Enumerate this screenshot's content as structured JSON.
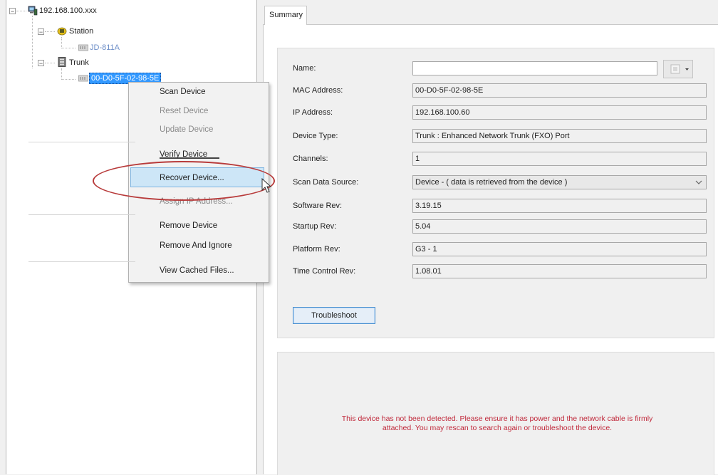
{
  "tree": {
    "root_label": "192.168.100.xxx",
    "station_label": "Station",
    "station_device_label": "JD-811A",
    "trunk_label": "Trunk",
    "trunk_device_label": "00-D0-5F-02-98-5E",
    "expand_symbol": "−"
  },
  "tabs": {
    "summary": "Summary"
  },
  "context_menu": {
    "items": [
      {
        "label": "Scan Device",
        "enabled": true
      },
      {
        "label": "Reset Device",
        "enabled": false
      },
      {
        "label": "Update Device",
        "enabled": false
      },
      {
        "label": "Verify Device",
        "enabled": true
      },
      {
        "label": "Recover Device...",
        "enabled": true
      },
      {
        "label": "Assign IP Address...",
        "enabled": false
      },
      {
        "label": "Remove Device",
        "enabled": true
      },
      {
        "label": "Remove And Ignore",
        "enabled": true
      },
      {
        "label": "View Cached Files...",
        "enabled": true
      }
    ]
  },
  "form": {
    "name_label": "Name:",
    "name_value": "",
    "mac_label": "MAC Address:",
    "mac_value": "00-D0-5F-02-98-5E",
    "ip_label": "IP Address:",
    "ip_value": "192.168.100.60",
    "device_type_label": "Device Type:",
    "device_type_value": "Trunk : Enhanced Network Trunk (FXO) Port",
    "channels_label": "Channels:",
    "channels_value": "1",
    "scan_source_label": "Scan Data Source:",
    "scan_source_value": "Device - ( data is retrieved from the device )",
    "software_rev_label": "Software Rev:",
    "software_rev_value": "3.19.15",
    "startup_rev_label": "Startup Rev:",
    "startup_rev_value": "5.04",
    "platform_rev_label": "Platform Rev:",
    "platform_rev_value": "G3 - 1",
    "time_control_rev_label": "Time Control Rev:",
    "time_control_rev_value": "1.08.01",
    "troubleshoot_label": "Troubleshoot"
  },
  "message": {
    "line1": "This device has not been detected.  Please ensure it has power and the network cable is firmly",
    "line2": "attached.  You may rescan to search again or troubleshoot the device."
  },
  "colors": {
    "selection": "#3399ff",
    "message_red": "#c0283a",
    "highlight_ellipse": "#b83b3b",
    "disabled_text": "#8a8a8a"
  },
  "icons": {
    "root": "network-computer-icon",
    "station": "station-phone-icon",
    "station_device": "device-module-icon",
    "trunk": "trunk-card-icon",
    "trunk_device": "device-module-icon",
    "name_button": "device-picture-icon",
    "dropdown": "chevron-down-icon"
  }
}
